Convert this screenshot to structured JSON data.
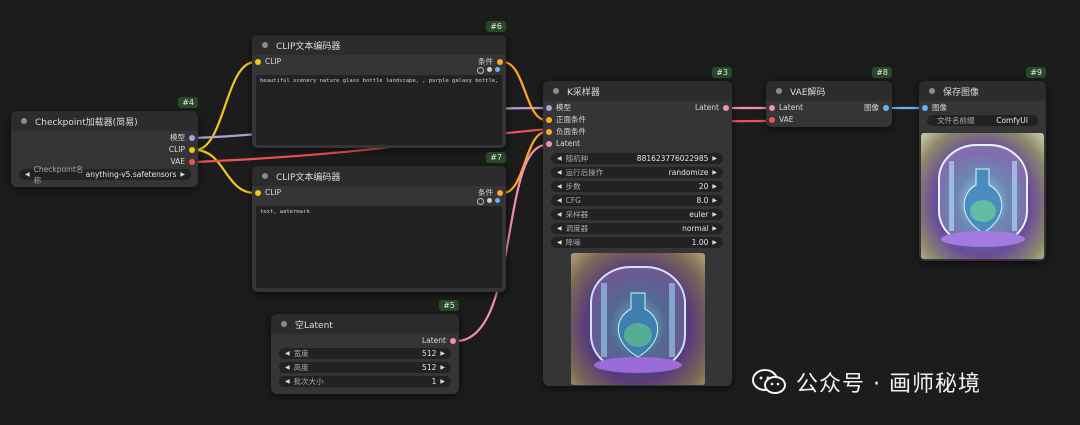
{
  "nodes": {
    "checkpoint": {
      "id": "#4",
      "title": "Checkpoint加载器(简易)",
      "outputs": [
        "模型",
        "CLIP",
        "VAE"
      ],
      "widget": {
        "label": "Checkpoint名称",
        "value": "anything-v5.safetensors"
      }
    },
    "clip_pos": {
      "id": "#6",
      "title": "CLIP文本编码器",
      "input": "CLIP",
      "output": "条件",
      "text": "beautiful scenery nature glass bottle landscape, , purple galaxy bottle,"
    },
    "clip_neg": {
      "id": "#7",
      "title": "CLIP文本编码器",
      "input": "CLIP",
      "output": "条件",
      "text": "text, watermark"
    },
    "empty_latent": {
      "id": "#5",
      "title": "空Latent",
      "output": "Latent",
      "widgets": [
        {
          "label": "宽度",
          "value": "512"
        },
        {
          "label": "高度",
          "value": "512"
        },
        {
          "label": "批次大小",
          "value": "1"
        }
      ]
    },
    "ksampler": {
      "id": "#3",
      "title": "K采样器",
      "inputs": [
        "模型",
        "正面条件",
        "负面条件",
        "Latent"
      ],
      "output": "Latent",
      "widgets": [
        {
          "label": "随机种",
          "value": "881623776022985"
        },
        {
          "label": "运行后操作",
          "value": "randomize"
        },
        {
          "label": "步数",
          "value": "20"
        },
        {
          "label": "CFG",
          "value": "8.0"
        },
        {
          "label": "采样器",
          "value": "euler"
        },
        {
          "label": "调度器",
          "value": "normal"
        },
        {
          "label": "降噪",
          "value": "1.00"
        }
      ]
    },
    "vae_decode": {
      "id": "#8",
      "title": "VAE解码",
      "inputs": [
        "Latent",
        "VAE"
      ],
      "output": "图像"
    },
    "save_image": {
      "id": "#9",
      "title": "保存图像",
      "input": "图像",
      "widget": {
        "label": "文件名前缀",
        "value": "ComfyUI"
      }
    }
  },
  "watermark": {
    "text": "公众号 · 画师秘境"
  },
  "colors": {
    "clip": "#f5c518",
    "model": "#b39ddb",
    "vae": "#ef5350",
    "conditioning": "#ffa726",
    "latent": "#f48fb1",
    "image": "#64b5f6",
    "node_bg": "#353535",
    "canvas_bg": "#1c1c1c"
  }
}
